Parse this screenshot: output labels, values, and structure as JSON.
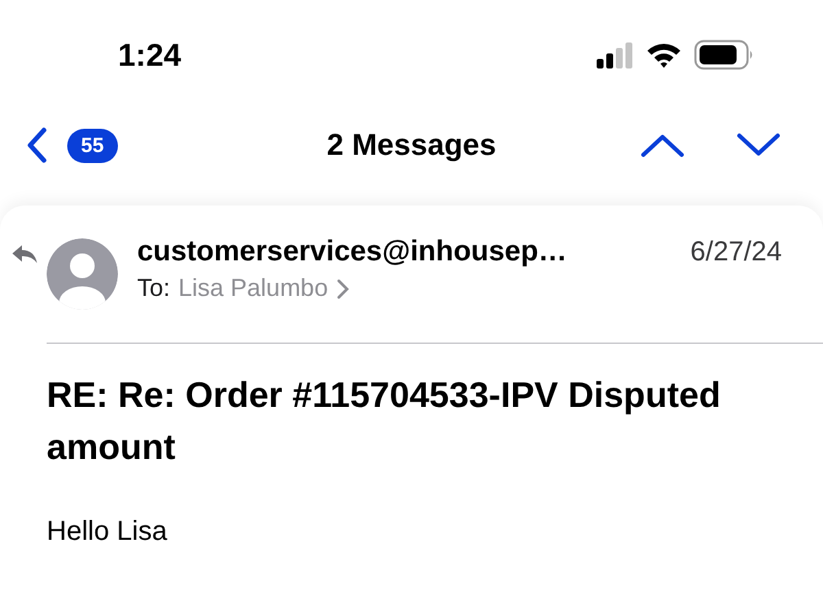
{
  "status_bar": {
    "time": "1:24"
  },
  "nav": {
    "unread_count": "55",
    "title": "2 Messages"
  },
  "message": {
    "sender": "customerservices@inhousep…",
    "date": "6/27/24",
    "to_label": "To:",
    "recipient": "Lisa Palumbo",
    "replied": true,
    "subject": "RE: Re: Order #115704533-IPV Disputed amount",
    "body": "Hello Lisa"
  }
}
